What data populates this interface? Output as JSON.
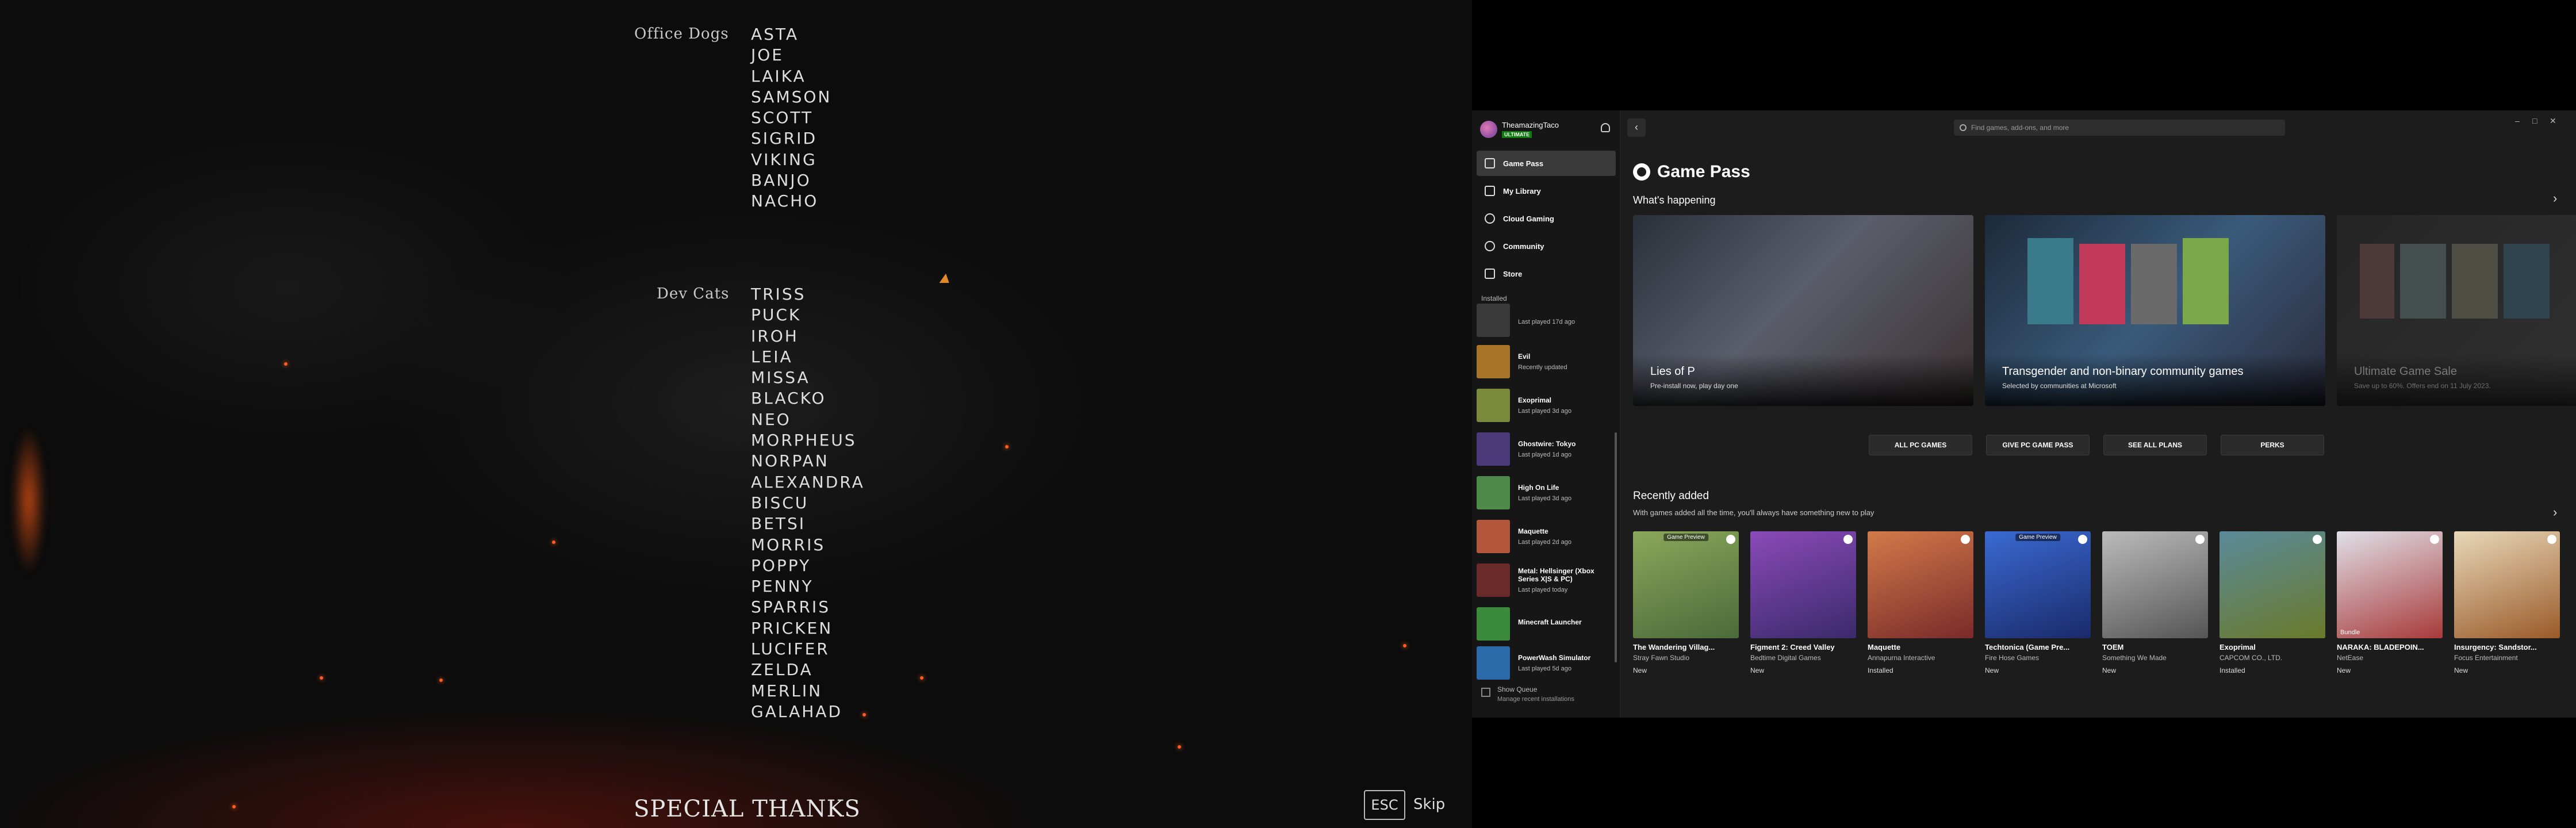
{
  "credits": {
    "office_dogs": {
      "heading": "Office Dogs",
      "names": [
        "ASTA",
        "JOE",
        "LAIKA",
        "SAMSON",
        "SCOTT",
        "SIGRID",
        "VIKING",
        "BANJO",
        "NACHO"
      ]
    },
    "dev_cats": {
      "heading": "Dev Cats",
      "names": [
        "TRISS",
        "PUCK",
        "IROH",
        "LEIA",
        "MISSA",
        "BLACKO",
        "NEO",
        "MORPHEUS",
        "NORPAN",
        "ALEXANDRA",
        "BISCU",
        "BETSI",
        "MORRIS",
        "POPPY",
        "PENNY",
        "SPARRIS",
        "PRICKEN",
        "LUCIFER",
        "ZELDA",
        "MERLIN",
        "GALAHAD"
      ]
    },
    "special_thanks": "SPECIAL THANKS",
    "esc_key": "ESC",
    "skip_label": "Skip"
  },
  "xbox": {
    "profile": {
      "gamertag": "TheamazingTaco",
      "badge": "ULTIMATE"
    },
    "nav": [
      {
        "label": "Game Pass",
        "icon": "home-icon",
        "active": true
      },
      {
        "label": "My Library",
        "icon": "library-icon",
        "active": false
      },
      {
        "label": "Cloud Gaming",
        "icon": "cloud-icon",
        "active": false
      },
      {
        "label": "Community",
        "icon": "community-icon",
        "active": false
      },
      {
        "label": "Store",
        "icon": "store-icon",
        "active": false
      }
    ],
    "installed_label": "Installed",
    "installed": [
      {
        "name": "",
        "sub": "Last played 17d ago",
        "color": "#3a3a3a"
      },
      {
        "name": "Evil",
        "sub": "Recently updated",
        "color": "#a8742a"
      },
      {
        "name": "Exoprimal",
        "sub": "Last played 3d ago",
        "color": "#7a8a3a"
      },
      {
        "name": "Ghostwire: Tokyo",
        "sub": "Last played 1d ago",
        "color": "#4a3a7a"
      },
      {
        "name": "High On Life",
        "sub": "Last played 3d ago",
        "color": "#4f8a4a"
      },
      {
        "name": "Maquette",
        "sub": "Last played 2d ago",
        "color": "#b2573a"
      },
      {
        "name": "Metal: Hellsinger (Xbox Series X|S & PC)",
        "sub": "Last played today",
        "color": "#6a2a2a"
      },
      {
        "name": "Minecraft Launcher",
        "sub": "",
        "color": "#3c8a3c"
      },
      {
        "name": "PowerWash Simulator",
        "sub": "Last played 5d ago",
        "color": "#2a6aa8"
      }
    ],
    "queue": {
      "title": "Show Queue",
      "sub": "Manage recent installations"
    },
    "search_placeholder": "Find games, add-ons, and more",
    "page_title": "Game Pass",
    "whats_happening": "What's happening",
    "heroes": [
      {
        "title": "Lies of P",
        "sub": "Pre-install now, play day one",
        "color": "#4a4e5a"
      },
      {
        "title": "Transgender and non-binary community games",
        "sub": "Selected by communities at Microsoft",
        "color": "#2a3a4a"
      },
      {
        "title": "Ultimate Game Sale",
        "sub": "Save up to 60%. Offers end on 11 July 2023.",
        "color": "#333333"
      }
    ],
    "buttons": [
      "ALL PC GAMES",
      "GIVE PC GAME PASS",
      "SEE ALL PLANS",
      "PERKS"
    ],
    "recently_added": "Recently added",
    "recently_added_sub": "With games added all the time, you'll always have something new to play",
    "tiles": [
      {
        "name": "The Wandering Villag...",
        "pub": "Stray Fawn Studio",
        "status": "New",
        "badge": "Game Preview",
        "color": "#6a8a4a"
      },
      {
        "name": "Figment 2: Creed Valley",
        "pub": "Bedtime Digital Games",
        "status": "New",
        "badge": "",
        "color": "#6a3a8a"
      },
      {
        "name": "Maquette",
        "pub": "Annapurna Interactive",
        "status": "Installed",
        "badge": "",
        "color": "#b2573a"
      },
      {
        "name": "Techtonica (Game Pre...",
        "pub": "Fire Hose Games",
        "status": "New",
        "badge": "Game Preview",
        "color": "#2a4a9a"
      },
      {
        "name": "TOEM",
        "pub": "Something We Made",
        "status": "New",
        "badge": "",
        "color": "#8a8a8a"
      },
      {
        "name": "Exoprimal",
        "pub": "CAPCOM CO., LTD.",
        "status": "Installed",
        "badge": "",
        "color": "#6a7a3a"
      },
      {
        "name": "NARAKA: BLADEPOIN...",
        "pub": "NetEase",
        "status": "New",
        "badge": "",
        "bundle": "Bundle",
        "color": "#a83a3a"
      },
      {
        "name": "Insurgency: Sandstor...",
        "pub": "Focus Entertainment",
        "status": "New",
        "badge": "",
        "color": "#9a6a3a"
      }
    ]
  }
}
